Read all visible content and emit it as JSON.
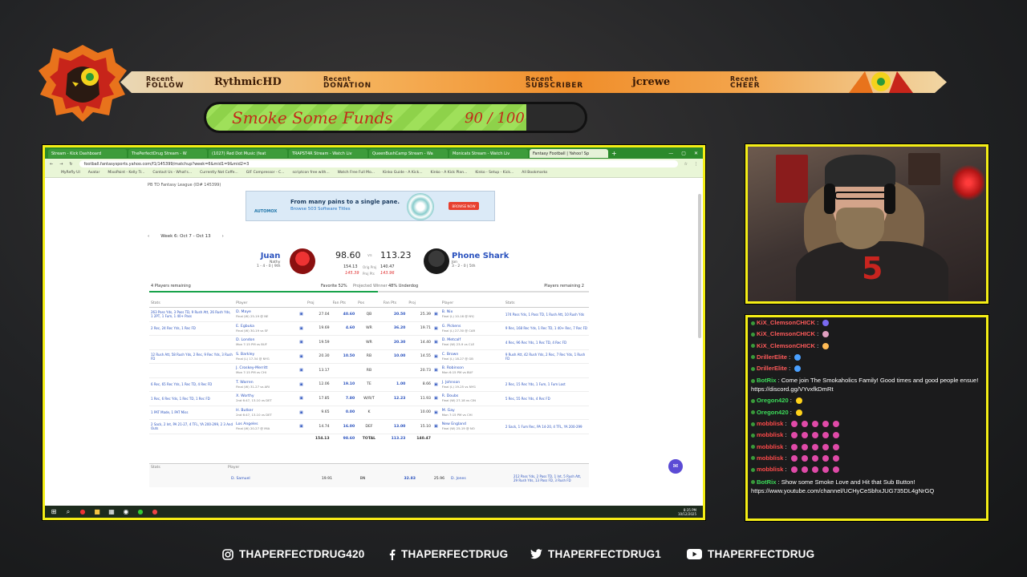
{
  "banner": {
    "follow_small": "Recent",
    "follow_big": "FOLLOW",
    "follow_name": "RythmicHD",
    "donation_small": "Recent",
    "donation_big": "DONATION",
    "subscriber_small": "Recent",
    "subscriber_big": "SUBSCRIBER",
    "subscriber_name": "jcrewe",
    "cheer_small": "Recent",
    "cheer_big": "CHEER"
  },
  "goal": {
    "title": "Smoke Some Funds",
    "count": "90 / 100",
    "progress_fraction": 0.9
  },
  "browser": {
    "tabs": [
      "Stream - Kick Dashboard",
      "ThePerfectDrug Stream - W",
      "(1027) Red Dot Music (feat",
      "TRAPST4R Stream - Watch Liv",
      "QueenBushCamp Stream - Wa",
      "Monicats Stream - Watch Liv",
      "Fantasy Football | Yahoo! Sp"
    ],
    "url": "football.fantasysports.yahoo.com/f1/145399/matchup?week=6&mid1=9&mid2=3",
    "bookmarks": [
      "MyRefly UI",
      "Avatar",
      "MixoPaint - Kelly Tr...",
      "Contact Us - What's...",
      "Currently Not Coffe...",
      "GIF Compressor - C...",
      "scriptcon free with...",
      "Watch Free Full Mo...",
      "Kinko Guide - A Kick...",
      "Kinko - A Kick Plan...",
      "Kinko - Setup - Kick...",
      "All Bookmarks"
    ]
  },
  "fantasy": {
    "league": "PB TD Fantasy League (ID# 145399)",
    "ad": {
      "brand": "AUTOMOX",
      "headline": "From many pains to a single pane.",
      "sub": "Browse 503 Software Titles",
      "button": "BROWSE NOW"
    },
    "week": {
      "prev": "‹",
      "label": "Week 6: Oct 7 - Oct 13",
      "next": "›"
    },
    "left": {
      "name": "Juan",
      "manager": "Nathy",
      "record": "1 - 4 - 0 | 9th",
      "score": "98.60",
      "proj": "154.13",
      "proj_win": "145.39"
    },
    "vs": "vs",
    "right": {
      "name": "Phone Shark",
      "manager": "Jon",
      "record": "3 - 2 - 0 | 5th",
      "score": "113.23",
      "proj": "140.47",
      "proj_win": "143.96"
    },
    "proj_lab1": "Orig Proj",
    "proj_lab2": "Proj Pts",
    "players_remaining_left": "4 Players remaining",
    "favorite": "Favorite 52%",
    "projected_winner": "Projected Winner",
    "underdog": "48% Underdog",
    "players_remaining_right": "Players remaining 2",
    "favorite_fraction": 0.52,
    "headers": [
      "Stats",
      "Player",
      "",
      "Proj",
      "Fan Pts",
      "Pos",
      "Fan Pts",
      "Proj",
      "",
      "Player",
      "Stats"
    ],
    "rows": [
      {
        "lstats": "263 Pass Yds, 3 Pass TD, 9 Rush Att, 26 Rush Yds, 1 2PT, 1 Fum, 1 40+ Pass",
        "lp": "D. Maye",
        "lg": "Final (W) 25-19 @ NE",
        "lproj": "27.04",
        "lfp": "40.60",
        "pos": "QB",
        "rfp": "20.50",
        "rproj": "25.39",
        "rp": "B. Nix",
        "rg": "Final (L) 10-16 @ NYJ",
        "rstats": "174 Pass Yds, 1 Pass TD, 1 Rush Att, 10 Rush Yds"
      },
      {
        "lstats": "2 Rec, 24 Rec Yds, 1 Rec FD",
        "lp": "E. Egbuka",
        "lg": "Final (W) 30-19 vs SF",
        "lproj": "19.69",
        "lfp": "4.60",
        "pos": "WR",
        "rfp": "36.20",
        "rproj": "19.71",
        "rp": "G. Pickens",
        "rg": "Final (L) 27-30 @ CAR",
        "rstats": "9 Rec, 168 Rec Yds, 1 Rec TD, 1 40+ Rec, 7 Rec FD"
      },
      {
        "lstats": "",
        "lp": "D. London",
        "lg": "Mon 7:15 PM vs BUF",
        "lproj": "19.59",
        "lfp": "",
        "pos": "WR",
        "rfp": "20.30",
        "rproj": "14.40",
        "rp": "D. Metcalf",
        "rg": "Final (W) 23-9 vs CLE",
        "rstats": "4 Rec, 96 Rec Yds, 1 Rec TD, 4 Rec FD"
      },
      {
        "lstats": "12 Rush Att, 58 Rush Yds, 2 Rec, 9 Rec Yds, 3 Rush FD",
        "lp": "S. Barkley",
        "lg": "Final (L) 17-34 @ NYG",
        "lproj": "20.30",
        "lfp": "10.50",
        "pos": "RB",
        "rfp": "10.00",
        "rproj": "14.55",
        "rp": "C. Brown",
        "rg": "Final (L) 18-27 @ GB",
        "rstats": "9 Rush Att, 42 Rush Yds, 2 Rec, 7 Rec Yds, 1 Rush FD"
      },
      {
        "lstats": "",
        "lp": "J. Croskey-Merritt",
        "lg": "Mon 7:15 PM vs CHI",
        "lproj": "13.17",
        "lfp": "",
        "pos": "RB",
        "rfp": "",
        "rproj": "20.73",
        "rp": "B. Robinson",
        "rg": "Mon 6:15 PM vs BUF",
        "rstats": ""
      },
      {
        "lstats": "6 Rec, 65 Rec Yds, 1 Rec TD, 4 Rec FD",
        "lp": "T. Warren",
        "lg": "Final (W) 31-27 vs ARI",
        "lproj": "12.06",
        "lfp": "19.10",
        "pos": "TE",
        "rfp": "1.00",
        "rproj": "8.66",
        "rp": "J. Johnson",
        "rg": "Final (L) 19-25 vs NYG",
        "rstats": "2 Rec, 15 Rec Yds, 1 Fum, 1 Fum Lost"
      },
      {
        "lstats": "1 Rec, 6 Rec Yds, 1 Rec TD, 1 Rec FD",
        "lp": "X. Worthy",
        "lg": "2nd 6:47, 13-10 vs DET",
        "lproj": "17.85",
        "lfp": "7.80",
        "pos": "W/R/T",
        "rfp": "12.23",
        "rproj": "11.93",
        "rp": "R. Doubs",
        "rg": "Final (W) 27-18 vs CIN",
        "rstats": "5 Rec, 55 Rec Yds, 4 Rec FD"
      },
      {
        "lstats": "1 PAT Made, 1 PAT Miss",
        "lp": "H. Butker",
        "lg": "2nd 6:47, 13-10 vs DET",
        "lproj": "9.65",
        "lfp": "0.00",
        "pos": "K",
        "rfp": "",
        "rproj": "10.00",
        "rp": "M. Gay",
        "rg": "Mon 7:15 PM vs CHI",
        "rstats": ""
      },
      {
        "lstats": "2 Sack, 2 Int, PA 21-27, 4 TFL, YA 200-299, 2 3 And Outs",
        "lp": "Los Angeles",
        "lg": "Final (W) 20-27 @ MIA",
        "lproj": "14.74",
        "lfp": "16.00",
        "pos": "DEF",
        "rfp": "13.00",
        "rproj": "15.10",
        "rp": "New England",
        "rg": "Final (W) 25-19 @ NO",
        "rstats": "2 Sack, 1 Fum Rec, PA 14-20, 4 TFL, YA 200-299"
      }
    ],
    "totals": {
      "lproj": "154.13",
      "lfp": "98.60",
      "label": "TOTAL",
      "rfp": "113.23",
      "rproj": "140.47"
    },
    "bench": {
      "lp": "D. Samuel",
      "lg": "Mon 7:15 PM vs CHI",
      "lproj": "19.91",
      "pos": "BN",
      "rfp": "32.83",
      "rproj": "25.96",
      "rp": "D. Jones",
      "rg": "Final (W) 31-27 vs ARI",
      "rstats": "212 Pass Yds, 2 Pass TD, 1 Int, 5 Rush Att, 29 Rush Yds, 13 Pass FD, 3 Rush FD"
    }
  },
  "taskbar": {
    "time": "8:35 PM",
    "date": "10/12/2025"
  },
  "chat": [
    {
      "user": "KiX_ClemsonCHICK",
      "color": "#ff5a5a",
      "text": " : ",
      "emote": "#7a6af0"
    },
    {
      "user": "KiX_ClemsonCHICK",
      "color": "#ff5a5a",
      "text": " : ",
      "emote": "#e0a0c0"
    },
    {
      "user": "KiX_ClemsonCHICK",
      "color": "#ff5a5a",
      "text": " : ",
      "emote": "#ffbb55"
    },
    {
      "user": "DrillerElite",
      "color": "#ff5a5a",
      "text": " : ",
      "emote": "#4aa0ff"
    },
    {
      "user": "DrillerElite",
      "color": "#ff5a5a",
      "text": " : ",
      "emote": "#4aa0ff"
    },
    {
      "user": "BotRix",
      "color": "#3ddc5a",
      "text": " : Come join The Smokaholics Family! Good times and good people ensue! https://discord.gg/VYvxfkDmRt",
      "wrap": true
    },
    {
      "user": "Oregon420",
      "color": "#3ddc5a",
      "text": " : ",
      "emote": "#ffd21a"
    },
    {
      "user": "Oregon420",
      "color": "#3ddc5a",
      "text": " : ",
      "emote": "#ffd21a"
    },
    {
      "user": "mobblisk",
      "color": "#ff4a4a",
      "text": " : ",
      "emote": "#e04aa8",
      "multi": 5
    },
    {
      "user": "mobblisk",
      "color": "#ff4a4a",
      "text": " : ",
      "emote": "#e04aa8",
      "multi": 5
    },
    {
      "user": "mobblisk",
      "color": "#ff4a4a",
      "text": " : ",
      "emote": "#e04aa8",
      "multi": 5
    },
    {
      "user": "mobblisk",
      "color": "#ff4a4a",
      "text": " : ",
      "emote": "#e04aa8",
      "multi": 5
    },
    {
      "user": "mobblisk",
      "color": "#ff4a4a",
      "text": " : ",
      "emote": "#e04aa8",
      "multi": 5
    },
    {
      "user": "BotRix",
      "color": "#3ddc5a",
      "text": " : Show some Smoke Love and Hit that Sub Button! https://www.youtube.com/channel/UCHyCeSbhxJUG735DL4gNrGQ",
      "wrap": true
    }
  ],
  "social": {
    "instagram": "THAPERFECTDRUG420",
    "facebook": "THAPERFECTDRUG",
    "twitter": "THAPERFECTDRUG1",
    "youtube": "THAPERFECTDRUG"
  },
  "colors": {
    "frame": "#f4ee16",
    "banner_orange": "#f08e2b",
    "goal_green": "#9fe05a",
    "goal_text": "#c22a1a"
  }
}
